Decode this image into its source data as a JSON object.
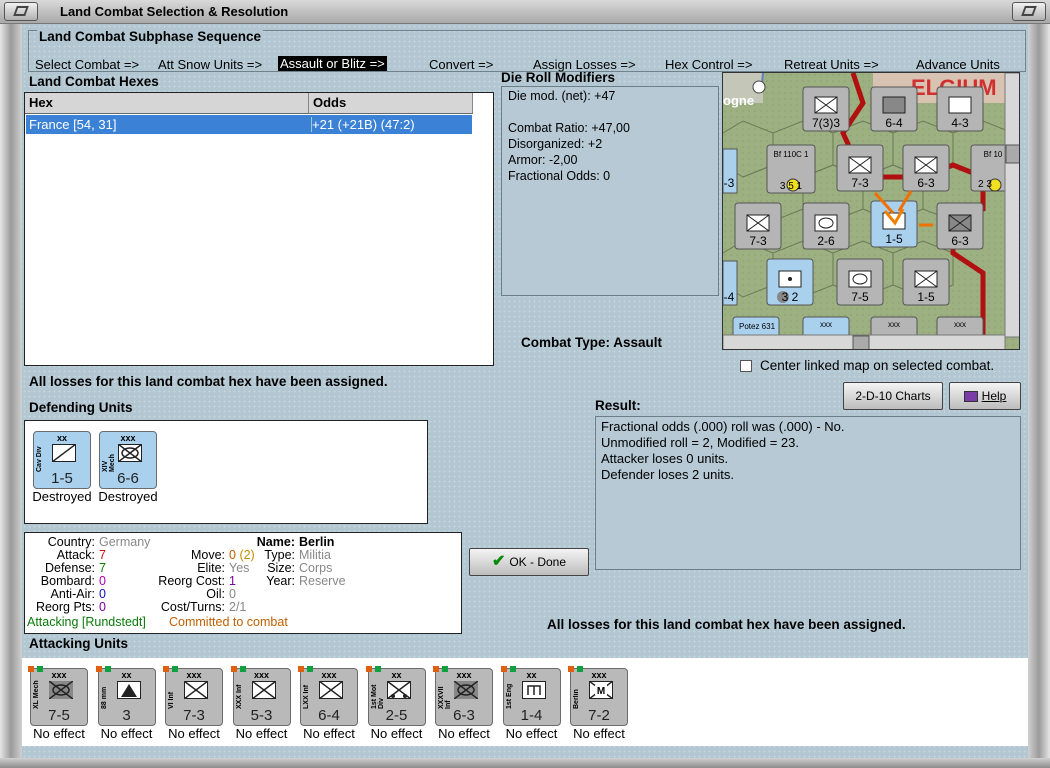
{
  "window": {
    "title": "Land Combat Selection & Resolution"
  },
  "subphase": {
    "title": "Land Combat Subphase Sequence",
    "steps": [
      "Select Combat =>",
      "Att Snow Units =>",
      "Assault or Blitz =>",
      "Convert =>",
      "Assign Losses =>",
      "Hex Control =>",
      "Retreat Units =>",
      "Advance Units"
    ]
  },
  "hexes": {
    "title": "Land Combat Hexes",
    "col_hex": "Hex",
    "col_odds": "Odds",
    "rows": [
      {
        "hex": "France [54, 31]",
        "odds": "+21 (+21B) (47:2)"
      }
    ]
  },
  "die_mods": {
    "title": "Die Roll Modifiers",
    "lines": [
      "Die mod. (net): +47",
      "",
      "Combat Ratio: +47,00",
      "Disorganized: +2",
      "Armor: -2,00",
      "Fractional Odds: 0"
    ]
  },
  "combat_type": {
    "label": "Combat Type:",
    "value": "Assault"
  },
  "map": {
    "center_label": "Center linked map on selected combat.",
    "partial_text": "ogne",
    "hexes": [
      {
        "size": "xxxxx",
        "str": "7(3)3"
      },
      {
        "size": "xx",
        "str": "6-4"
      },
      {
        "size": "xx",
        "str": "4-3"
      },
      {
        "size": "",
        "str": "-3"
      },
      {
        "size": "Bf 110C 1",
        "str": "3 5 1"
      },
      {
        "size": "xxx",
        "str": "7-3"
      },
      {
        "size": "xx",
        "str": "6-3"
      },
      {
        "size": "Bf 10",
        "str": "2 3"
      },
      {
        "size": "xxx",
        "str": "7-3"
      },
      {
        "size": "xx",
        "str": "2-6"
      },
      {
        "size": "xx",
        "str": "1-5"
      },
      {
        "size": "xxx",
        "str": "6-3"
      },
      {
        "size": "",
        "str": "-4"
      },
      {
        "size": "xx",
        "str": "3 2"
      },
      {
        "size": "xxx",
        "str": "7-5"
      },
      {
        "size": "xxx",
        "str": "1-5"
      },
      {
        "size": "Potez 631",
        "str": ""
      },
      {
        "size": "xxx",
        "str": ""
      },
      {
        "size": "xxx",
        "str": ""
      },
      {
        "size": "xxx",
        "str": ""
      }
    ]
  },
  "status_msg": "All losses for this land combat hex have been assigned.",
  "buttons": {
    "charts": "2-D-10 Charts",
    "help": "Help",
    "ok": "OK - Done"
  },
  "result": {
    "title": "Result:",
    "lines": [
      "Fractional odds (.000) roll was (.000)  - No.",
      "Unmodified roll = 2, Modified = 23.",
      "Attacker loses 0 units.",
      "Defender loses 2 units."
    ]
  },
  "defending": {
    "title": "Defending Units",
    "units": [
      {
        "side": "Cav Div",
        "size": "xx",
        "str": "1-5",
        "effect": "Destroyed",
        "type": "cav"
      },
      {
        "side": "XIV Mech",
        "size": "xxx",
        "str": "6-6",
        "effect": "Destroyed",
        "type": "mech"
      }
    ]
  },
  "info": {
    "country_l": "Country:",
    "country": "Germany",
    "attack_l": "Attack:",
    "attack": "7",
    "defense_l": "Defense:",
    "defense": "7",
    "bombard_l": "Bombard:",
    "bombard": "0",
    "aa_l": "Anti-Air:",
    "aa": "0",
    "reorg_l": "Reorg Pts:",
    "reorg": "0",
    "move_l": "Move:",
    "move": "0",
    "move2": "(2)",
    "elite_l": "Elite:",
    "elite": "Yes",
    "reorg_cost_l": "Reorg Cost:",
    "reorg_cost": "1",
    "oil_l": "Oil:",
    "oil": "0",
    "cost_l": "Cost/Turns:",
    "cost": "2/1",
    "name_l": "Name:",
    "name": "Berlin",
    "type_l": "Type:",
    "type": "Militia",
    "size_l": "Size:",
    "size": "Corps",
    "year_l": "Year:",
    "year": "Reserve",
    "status1": "Attacking [Rundstedt]",
    "status2": "Committed to combat"
  },
  "attacking": {
    "title": "Attacking Units",
    "units": [
      {
        "side": "XL Mech",
        "size": "xxx",
        "str": "7-5",
        "effect": "No effect",
        "type": "mech"
      },
      {
        "side": "88 mm",
        "size": "xx",
        "str": "3",
        "effect": "No effect",
        "type": "aa"
      },
      {
        "side": "VI Inf",
        "size": "xxx",
        "str": "7-3",
        "effect": "No effect",
        "type": "inf"
      },
      {
        "side": "XXX Inf",
        "size": "xxx",
        "str": "5-3",
        "effect": "No effect",
        "type": "inf"
      },
      {
        "side": "LXX Inf",
        "size": "xxx",
        "str": "6-4",
        "effect": "No effect",
        "type": "inf"
      },
      {
        "side": "1st Mot Div",
        "size": "xx",
        "str": "2-5",
        "effect": "No effect",
        "type": "mot"
      },
      {
        "side": "XXXVII Inf",
        "size": "xxx",
        "str": "6-3",
        "effect": "No effect",
        "type": "mech"
      },
      {
        "side": "1st Eng",
        "size": "xx",
        "str": "1-4",
        "effect": "No effect",
        "type": "eng"
      },
      {
        "side": "Berlin",
        "size": "xxx",
        "str": "7-2",
        "effect": "No effect",
        "type": "mil"
      }
    ]
  },
  "colors": {
    "accent_red": "#cc1010",
    "green": "#0a7a0a",
    "orange": "#c06000",
    "purple": "#7a00a0",
    "blue": "#1010c0",
    "selection": "#3b82d6"
  }
}
